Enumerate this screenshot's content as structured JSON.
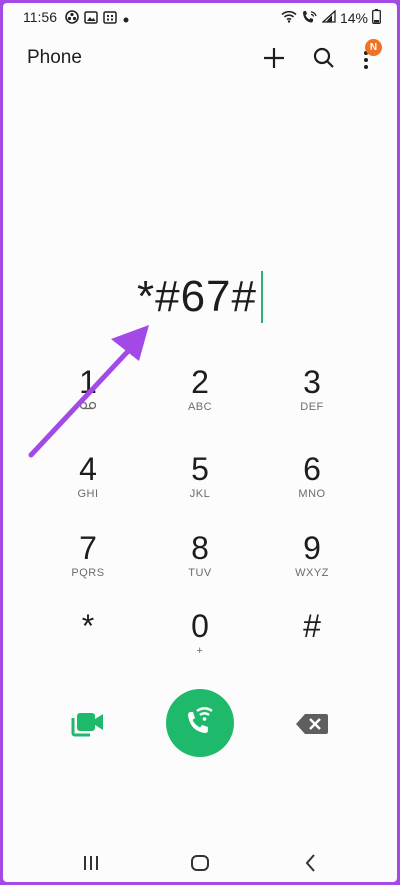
{
  "status_bar": {
    "time": "11:56",
    "battery": "14%"
  },
  "app": {
    "title": "Phone",
    "notification_badge": "N",
    "accent_color": "#1fb96b",
    "badge_color": "#f07224",
    "annotation_color": "#a349e6"
  },
  "dialer": {
    "entered_number": "*#67#"
  },
  "keypad": {
    "keys": [
      {
        "digit": "1",
        "letters": ""
      },
      {
        "digit": "2",
        "letters": "ABC"
      },
      {
        "digit": "3",
        "letters": "DEF"
      },
      {
        "digit": "4",
        "letters": "GHI"
      },
      {
        "digit": "5",
        "letters": "JKL"
      },
      {
        "digit": "6",
        "letters": "MNO"
      },
      {
        "digit": "7",
        "letters": "PQRS"
      },
      {
        "digit": "8",
        "letters": "TUV"
      },
      {
        "digit": "9",
        "letters": "WXYZ"
      },
      {
        "digit": "*",
        "letters": ""
      },
      {
        "digit": "0",
        "letters": "+"
      },
      {
        "digit": "#",
        "letters": ""
      }
    ]
  },
  "icons": {
    "toolbar": [
      "plus-icon",
      "search-icon",
      "more-vert-icon"
    ],
    "actions": [
      "video-call-icon",
      "wifi-call-icon",
      "backspace-icon"
    ],
    "nav": [
      "recents-icon",
      "home-icon",
      "back-icon"
    ]
  }
}
